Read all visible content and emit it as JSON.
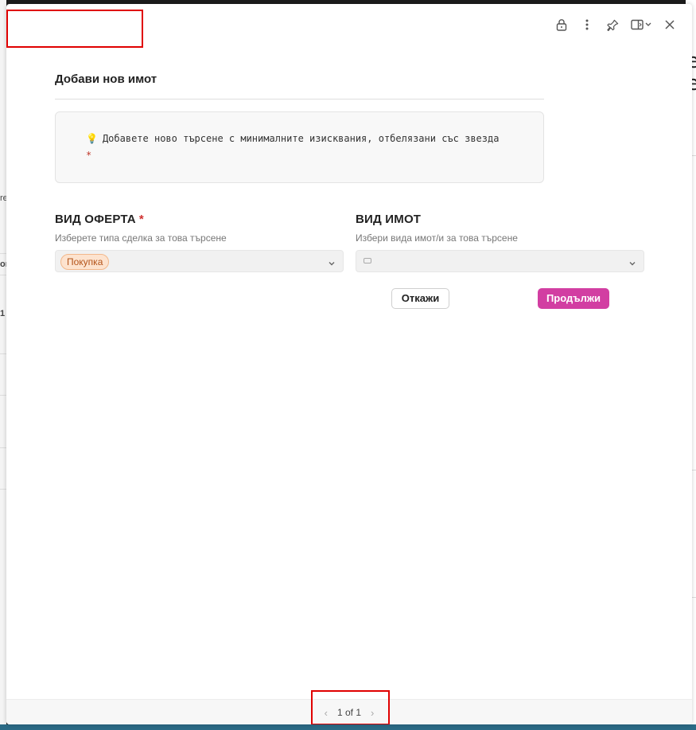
{
  "modal": {
    "title": "Добави нов имот",
    "callout": {
      "icon": "lightbulb-icon",
      "text": "Добавете ново търсене с минималните изисквания, отбелязани със звезда",
      "required_mark": "*"
    },
    "fields": {
      "offer_type": {
        "label": "ВИД ОФЕРТА",
        "required_mark": "*",
        "help": "Изберете типа сделка за това търсене",
        "selected": "Покупка"
      },
      "property_type": {
        "label": "ВИД ИМОТ",
        "help": "Избери вида имот/и за това търсене",
        "selected": ""
      }
    },
    "buttons": {
      "cancel": "Откажи",
      "continue": "Продължи"
    },
    "pagination": {
      "text": "1 of 1",
      "prev": "‹",
      "next": "›"
    }
  },
  "background": {
    "fragments": [
      "re",
      "or",
      "1"
    ],
    "right_chars": [
      "e",
      "e"
    ]
  },
  "colors": {
    "accent": "#d23ea2",
    "chip_text": "#b4541a",
    "chip_bg": "#fde3cf",
    "required": "#d0302f",
    "annotation": "#e00000"
  }
}
